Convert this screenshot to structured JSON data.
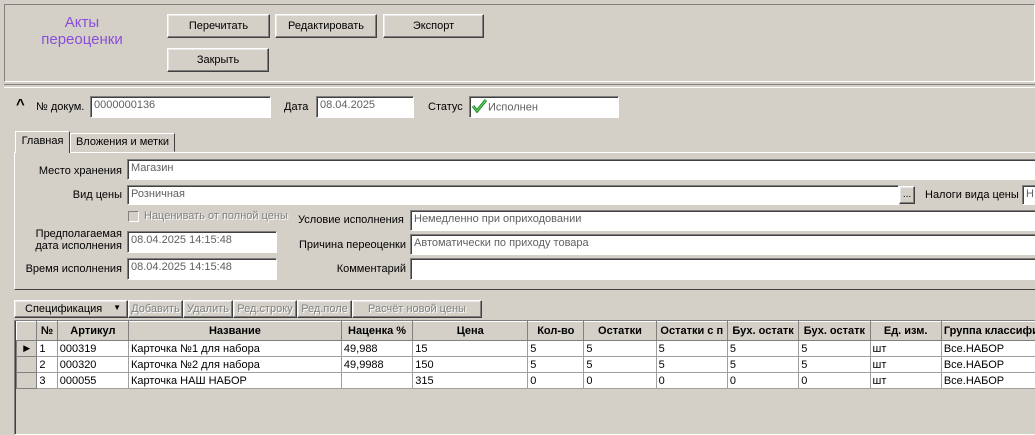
{
  "header": {
    "title_line1": "Акты",
    "title_line2": "переоценки",
    "buttons": {
      "reread": "Перечитать",
      "edit": "Редактировать",
      "export": "Экспорт",
      "close": "Закрыть"
    }
  },
  "doc": {
    "collapse_glyph": "^",
    "number_label": "№ докум.",
    "number_value": "0000000136",
    "date_label": "Дата",
    "date_value": "08.04.2025",
    "status_label": "Статус",
    "status_value": "Исполнен"
  },
  "tabs": {
    "main": "Главная",
    "attachments": "Вложения и метки"
  },
  "form": {
    "storage_label": "Место хранения",
    "storage_value": "Магазин",
    "price_type_label": "Вид цены",
    "price_type_value": "Розничная",
    "ellipsis": "...",
    "taxes_label": "Налоги вида цены",
    "taxes_value": "Н",
    "markup_checkbox_label": "Наценивать от полной цены",
    "condition_label": "Условие исполнения",
    "condition_value": "Немедленно при оприходовании",
    "planned_date_label_1": "Предполагаемая",
    "planned_date_label_2": "дата исполнения",
    "planned_date_value": "08.04.2025 14:15:48",
    "reason_label": "Причина переоценки",
    "reason_value": "Автоматически по приходу товара",
    "exec_time_label": "Время исполнения",
    "exec_time_value": "08.04.2025 14:15:48",
    "comment_label": "Комментарий",
    "comment_value": ""
  },
  "spec_toolbar": {
    "spec": "Спецификация",
    "dropdown_glyph": "▼",
    "add": "Добавить",
    "delete": "Удалить",
    "edit_row": "Ред.строку",
    "edit_field": "Ред.поле",
    "calc_price": "Расчёт новой цены"
  },
  "table": {
    "columns": [
      "№",
      "Артикул",
      "Название",
      "Наценка %",
      "Цена",
      "Кол-во",
      "Остатки",
      "Остатки с п",
      "Бух. остатк",
      "Бух. остатк",
      "Ед. изм.",
      "Группа классифика"
    ],
    "rows": [
      [
        "1",
        "000319",
        "Карточка №1 для набора",
        "49,988",
        "15",
        "5",
        "5",
        "5",
        "5",
        "5",
        "шт",
        "Все.НАБОР"
      ],
      [
        "2",
        "000320",
        "Карточка №2 для набора",
        "49,9988",
        "150",
        "5",
        "5",
        "5",
        "5",
        "5",
        "шт",
        "Все.НАБОР"
      ],
      [
        "3",
        "000055",
        "Карточка НАШ НАБОР",
        "",
        "315",
        "0",
        "0",
        "0",
        "0",
        "0",
        "шт",
        "Все.НАБОР"
      ]
    ],
    "current_row_marker": "▶"
  }
}
